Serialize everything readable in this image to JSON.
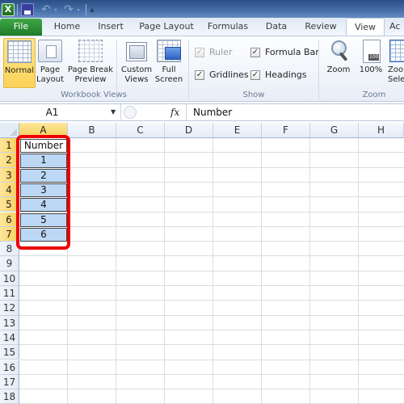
{
  "app": {
    "logo_letter": "X",
    "qat": {
      "save": "save-icon",
      "undo": "↶",
      "redo": "↷",
      "dropdown": "▾",
      "customize": "⩡"
    }
  },
  "tabs": [
    {
      "label": "File",
      "active": false
    },
    {
      "label": "Home",
      "active": false
    },
    {
      "label": "Insert",
      "active": false
    },
    {
      "label": "Page Layout",
      "active": false
    },
    {
      "label": "Formulas",
      "active": false
    },
    {
      "label": "Data",
      "active": false
    },
    {
      "label": "Review",
      "active": false
    },
    {
      "label": "View",
      "active": true
    },
    {
      "label": "Ac",
      "active": false
    }
  ],
  "ribbon": {
    "workbook_views": {
      "label": "Workbook Views",
      "buttons": [
        {
          "label1": "Normal",
          "label2": "",
          "active": true
        },
        {
          "label1": "Page",
          "label2": "Layout"
        },
        {
          "label1": "Page Break",
          "label2": "Preview"
        },
        {
          "label1": "Custom",
          "label2": "Views"
        },
        {
          "label1": "Full",
          "label2": "Screen"
        }
      ]
    },
    "show": {
      "label": "Show",
      "items": [
        {
          "label": "Ruler",
          "checked": true,
          "disabled": true
        },
        {
          "label": "Formula Bar",
          "checked": true,
          "disabled": false
        },
        {
          "label": "Gridlines",
          "checked": true,
          "disabled": false
        },
        {
          "label": "Headings",
          "checked": true,
          "disabled": false
        }
      ],
      "check_glyph": "✓"
    },
    "zoom": {
      "label": "Zoom",
      "buttons": [
        {
          "label1": "Zoom",
          "label2": ""
        },
        {
          "label1": "100%",
          "label2": ""
        },
        {
          "label1": "Zoo",
          "label2": "Sele"
        }
      ]
    }
  },
  "formula_bar": {
    "name_box": "A1",
    "dropdown": "▼",
    "fx": "fx",
    "value": "Number"
  },
  "sheet": {
    "columns": [
      "A",
      "B",
      "C",
      "D",
      "E",
      "F",
      "G",
      "H"
    ],
    "selected_column": "A",
    "rows": [
      "1",
      "2",
      "3",
      "4",
      "5",
      "6",
      "7",
      "8",
      "9",
      "10",
      "11",
      "12",
      "13",
      "14",
      "15",
      "16",
      "17",
      "18"
    ],
    "selected_rows": [
      "1",
      "2",
      "3",
      "4",
      "5",
      "6",
      "7"
    ],
    "cells_A": [
      "Number",
      "1",
      "2",
      "3",
      "4",
      "5",
      "6"
    ],
    "highlight_color": "#ee0000",
    "selection_fill": "#bcd8f5"
  }
}
